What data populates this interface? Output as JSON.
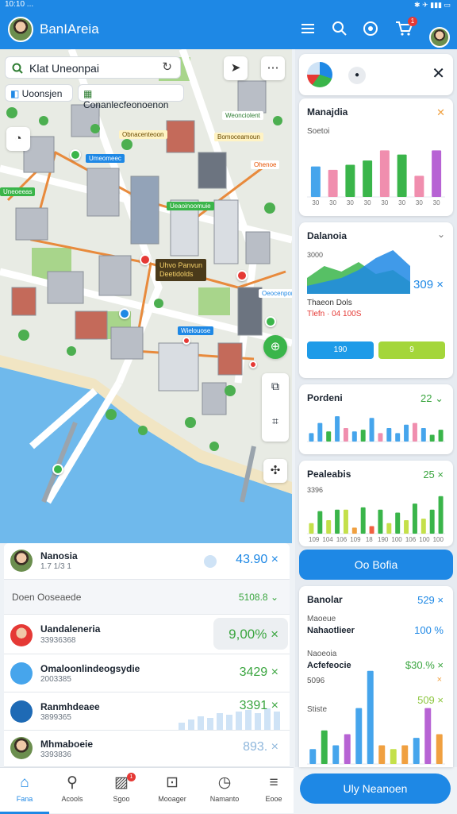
{
  "status": {
    "time": "10:10 ...",
    "icons": "✱ ✈ ▮▮▮ ▭"
  },
  "appbar": {
    "title": "BanIAreia",
    "icons": [
      "menu-icon",
      "search-icon",
      "globe-icon",
      "cart-icon",
      "avatar"
    ],
    "cart_badge": "1"
  },
  "map": {
    "search": {
      "value": "Klat Uneonpai"
    },
    "chips": [
      "Uoonsjen",
      "Conanlecfeonoenon"
    ],
    "labels": [
      "Obnacenteoon",
      "Umeomeec",
      "Weonciolent",
      "Bomoceamoun",
      "Ohenoe",
      "Ueaoinoomuie",
      "Uneoeeas",
      "Wielouose",
      "Oeocenpon"
    ],
    "callout": {
      "line1": "Uhvo Panvun",
      "line2": "Deetidolds"
    },
    "colors": {
      "water": "#6fb9ec",
      "park": "#a8d58b",
      "road": "#ffffff",
      "route": "#e88a3c"
    }
  },
  "list": {
    "top": {
      "name": "Nanosia",
      "sub": "1.7 1/3 1",
      "value": "43.90 ×"
    },
    "section": {
      "label": "Doen Ooseaede",
      "value": "5108.8 ⌄"
    },
    "rows": [
      {
        "name": "Uandaleneria",
        "sub": "33936368",
        "value": "9,00% ×"
      },
      {
        "name": "Omaloonlindeogsydie",
        "sub": "2003385",
        "value": "3429 ×"
      },
      {
        "name": "Ranmhdeaee",
        "sub": "3899365",
        "value": "3391 ×"
      },
      {
        "name": "Mhmaboeie",
        "sub": "3393836",
        "value": "893. ×"
      }
    ]
  },
  "right": {
    "header_icons": [
      "chart-icon",
      "drop-icon",
      "close-icon"
    ],
    "card1": {
      "title": "Manajdia",
      "sub": "Soetoi",
      "ticks": [
        "30",
        "30",
        "30",
        "30",
        "30",
        "30",
        "30",
        "30"
      ],
      "chart_data": {
        "type": "bar",
        "categories": [
          "1",
          "2",
          "3",
          "4",
          "5",
          "6",
          "7",
          "8"
        ],
        "values": [
          36,
          32,
          38,
          43,
          55,
          50,
          25,
          55
        ],
        "colors": [
          "#46a5ec",
          "#f08eae",
          "#3ab54a",
          "#3ab54a",
          "#f08eae",
          "#3ab54a",
          "#f08eae",
          "#b763d4"
        ],
        "ylim": [
          0,
          60
        ]
      }
    },
    "card2": {
      "title": "Dalanoia",
      "sub": "3000",
      "value": "309 ×",
      "legend1": "Thaeon Dols",
      "legend2a": "Tlefn",
      "legend2b": "04 100S",
      "btn1": "190",
      "btn2": "9",
      "chart_data": {
        "type": "area",
        "x": [
          "1",
          "2",
          "3",
          "4",
          "5",
          "6",
          "7"
        ],
        "series": [
          {
            "name": "green",
            "values": [
              20,
              35,
              28,
              40,
              25,
              30,
              15
            ],
            "color": "#3ab54a"
          },
          {
            "name": "blue",
            "values": [
              10,
              15,
              20,
              30,
              45,
              55,
              35
            ],
            "color": "#1e88e5"
          }
        ],
        "ylim": [
          0,
          60
        ]
      }
    },
    "card3": {
      "title": "Pordeni",
      "value": "22 ⌄",
      "chart_data": {
        "type": "bar",
        "categories": [
          "1",
          "2",
          "3",
          "4",
          "5",
          "6",
          "7",
          "8",
          "9",
          "10",
          "11",
          "12",
          "13",
          "14",
          "15",
          "16"
        ],
        "values": [
          10,
          22,
          12,
          30,
          16,
          12,
          14,
          28,
          10,
          16,
          10,
          20,
          22,
          16,
          8,
          14
        ],
        "colors": [
          "#46a5ec",
          "#46a5ec",
          "#3ab54a",
          "#46a5ec",
          "#f08eae",
          "#46a5ec",
          "#3ab54a",
          "#46a5ec",
          "#f08eae",
          "#46a5ec",
          "#46a5ec",
          "#46a5ec",
          "#f08eae",
          "#46a5ec",
          "#3ab54a",
          "#3ab54a"
        ],
        "ylim": [
          0,
          32
        ]
      }
    },
    "card4": {
      "title": "Pealeabis",
      "value": "25 ×",
      "sub": "3396",
      "ticks": [
        "109",
        "104",
        "106",
        "109",
        "18",
        "190",
        "100",
        "106",
        "100",
        "100"
      ],
      "chart_data": {
        "type": "bar",
        "categories": [
          "1",
          "2",
          "3",
          "4",
          "5",
          "6",
          "7",
          "8",
          "9",
          "10",
          "11",
          "12",
          "13",
          "14",
          "15",
          "16"
        ],
        "values": [
          14,
          30,
          18,
          32,
          32,
          8,
          35,
          10,
          32,
          14,
          28,
          18,
          40,
          20,
          32,
          50
        ],
        "colors": [
          "#c4e04a",
          "#3ab54a",
          "#c4e04a",
          "#3ab54a",
          "#c4e04a",
          "#f0a040",
          "#3ab54a",
          "#f06040",
          "#3ab54a",
          "#c4e04a",
          "#3ab54a",
          "#c4e04a",
          "#3ab54a",
          "#c4e04a",
          "#3ab54a",
          "#3ab54a"
        ],
        "ylim": [
          0,
          55
        ]
      }
    },
    "on_button": "Oo Bofia",
    "card5": {
      "title": "Banolar",
      "value": "529 ×",
      "rows": [
        {
          "label": "Maoeue",
          "strong": "Nahaotlieer",
          "value": "100 %"
        },
        {
          "label": "Naoeoia",
          "strong": "Acfefeocie",
          "value": "$30.% ×"
        },
        {
          "label": "5096",
          "strong": "",
          "value": "×"
        },
        {
          "label": "Stiste",
          "strong": "",
          "value": "509 ×"
        }
      ],
      "chart_data": {
        "type": "bar",
        "categories": [
          "1",
          "2",
          "3",
          "4",
          "5",
          "6",
          "7",
          "8",
          "9",
          "10",
          "11",
          "12"
        ],
        "values": [
          20,
          45,
          25,
          40,
          75,
          125,
          25,
          20,
          25,
          35,
          75,
          40
        ],
        "colors": [
          "#46a5ec",
          "#3ab54a",
          "#46a5ec",
          "#b763d4",
          "#46a5ec",
          "#46a5ec",
          "#f0a040",
          "#c4e04a",
          "#f0a040",
          "#46a5ec",
          "#b763d4",
          "#f0a040"
        ],
        "ylim": [
          0,
          130
        ]
      }
    },
    "footer_button": "Uly Neanoen"
  },
  "nav": [
    {
      "label": "Fana",
      "icon": "home-icon",
      "active": true
    },
    {
      "label": "Acools",
      "icon": "search-icon"
    },
    {
      "label": "Sgoo",
      "icon": "photo-icon",
      "badge": "1"
    },
    {
      "label": "Mooager",
      "icon": "bag-icon"
    },
    {
      "label": "Namanto",
      "icon": "clock-icon"
    },
    {
      "label": "Eooe",
      "icon": "menu-icon"
    }
  ]
}
